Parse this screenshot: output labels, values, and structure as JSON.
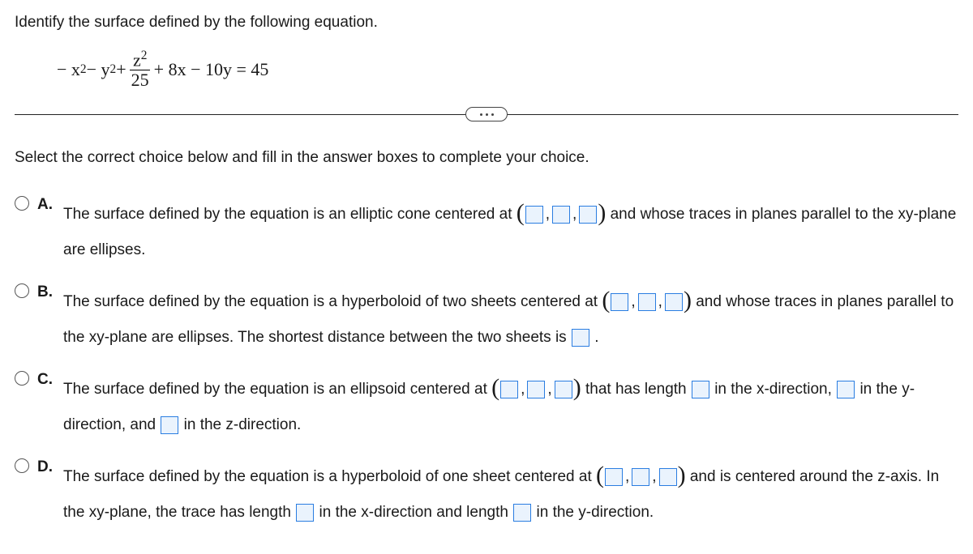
{
  "instruction": "Identify the surface defined by the following equation.",
  "equation": {
    "part1": "− x",
    "sup1": "2",
    "part2": " − y",
    "sup2": "2",
    "plus": " + ",
    "frac_num_z": "z",
    "frac_num_sup": "2",
    "frac_den": "25",
    "rest": " + 8x − 10y = 45"
  },
  "prompt": "Select the correct choice below and fill in the answer boxes to complete your choice.",
  "choices": {
    "A": {
      "label": "A.",
      "t1": "The surface defined by the equation is an elliptic cone centered at ",
      "t2": " and whose traces in planes parallel to the xy-plane are ellipses."
    },
    "B": {
      "label": "B.",
      "t1": "The surface defined by the equation is a hyperboloid of two sheets centered at ",
      "t2": " and whose traces in planes parallel to the xy-plane are ellipses. The shortest distance between the two sheets is ",
      "t3": "."
    },
    "C": {
      "label": "C.",
      "t1": "The surface defined by the equation is an ellipsoid centered at ",
      "t2": " that has length ",
      "t3": " in the x-direction, ",
      "t4": " in the y-direction, and ",
      "t5": " in the z-direction."
    },
    "D": {
      "label": "D.",
      "t1": "The surface defined by the equation is a hyperboloid of one sheet centered at ",
      "t2": " and is centered around the z-axis. In the xy-plane, the trace has length ",
      "t3": " in the x-direction and length ",
      "t4": " in the y-direction."
    }
  }
}
